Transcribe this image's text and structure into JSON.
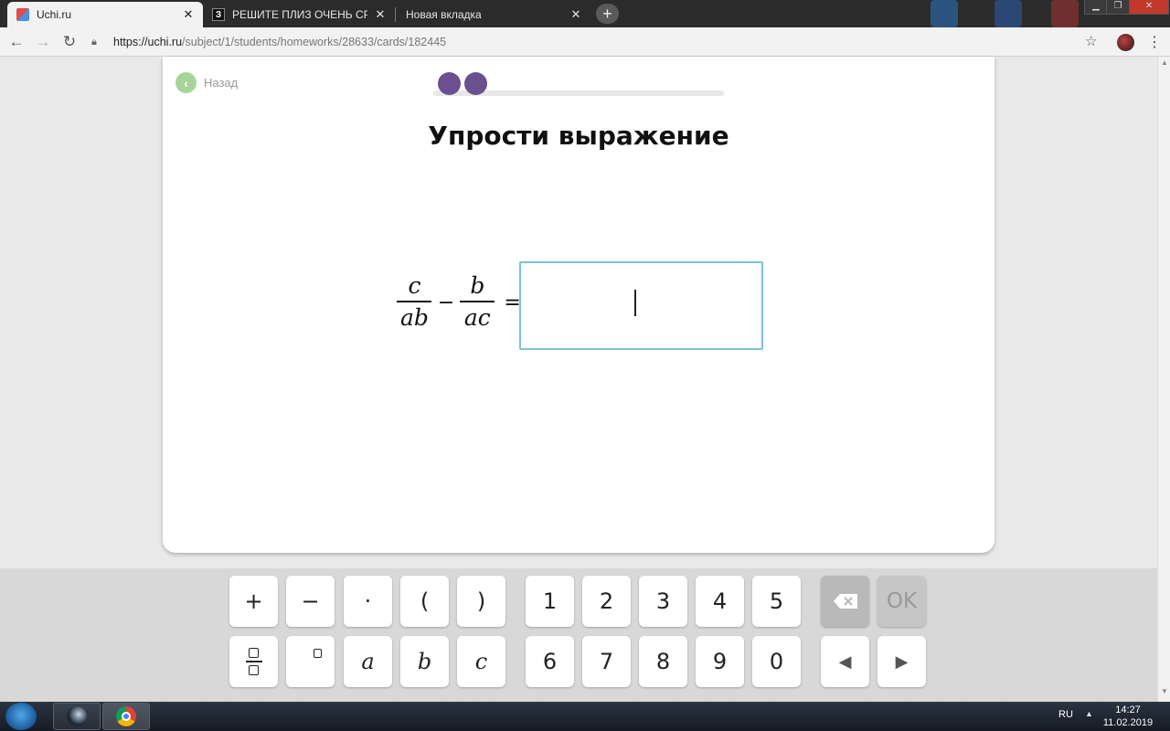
{
  "browser": {
    "tabs": [
      {
        "title": "Uchi.ru",
        "active": true
      },
      {
        "title": "РЕШИТЕ ПЛИЗ ОЧЕНЬ СРОЧНО",
        "active": false
      },
      {
        "title": "Новая вкладка",
        "active": false
      }
    ],
    "url_host": "https://uchi.ru",
    "url_path": "/subject/1/students/homeworks/28633/cards/182445"
  },
  "card": {
    "back_label": "Назад",
    "title": "Упрости выражение",
    "progress": {
      "completed": 2
    },
    "expression": {
      "frac1": {
        "num": "c",
        "den": "ab"
      },
      "operator": "−",
      "frac2": {
        "num": "b",
        "den": "ac"
      },
      "equals": "="
    },
    "answer_value": ""
  },
  "keyboard": {
    "row1": [
      "+",
      "−",
      "·",
      "(",
      ")",
      "1",
      "2",
      "3",
      "4",
      "5",
      "⌫",
      "OK"
    ],
    "row2": [
      "fraction",
      "degree",
      "a",
      "b",
      "c",
      "6",
      "7",
      "8",
      "9",
      "0",
      "◀",
      "▶"
    ]
  },
  "taskbar": {
    "lang": "RU",
    "time": "14:27",
    "date": "11.02.2019"
  },
  "icons": {
    "favicon_uchi": "uchi-favicon-icon",
    "favicon_znanija": "znanija-favicon-icon",
    "back": "chevron-left-icon",
    "backspace": "backspace-icon"
  },
  "colors": {
    "progress_dot": "#6a508f",
    "back_circle": "#a8d49a",
    "answer_border": "#7ec4d3"
  }
}
